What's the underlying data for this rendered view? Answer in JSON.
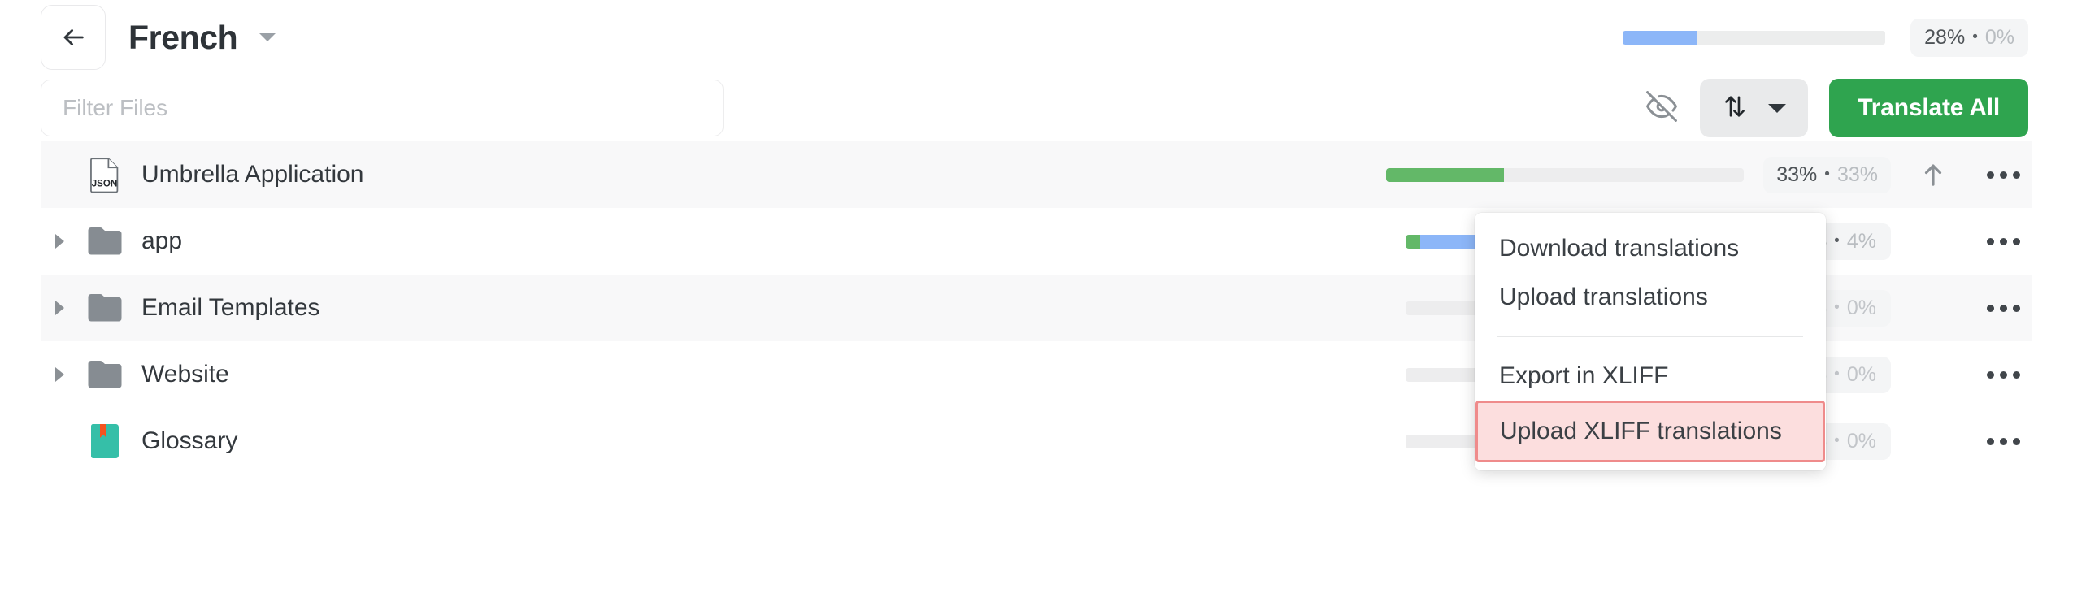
{
  "header": {
    "back_icon": "arrow-left-icon",
    "title": "French",
    "title_caret_icon": "chevron-down-icon",
    "progress_percent": 28,
    "stats_primary": "28%",
    "stats_separator": "•",
    "stats_secondary": "0%"
  },
  "toolbar": {
    "filter_placeholder": "Filter Files",
    "filter_value": "",
    "hide_icon": "eye-off-icon",
    "sort_icon": "sort-arrows-icon",
    "sort_caret_icon": "chevron-down-icon",
    "translate_all_label": "Translate All",
    "accent_green": "#2fa44f"
  },
  "menu": {
    "items": [
      {
        "label": "Download translations",
        "highlighted": false
      },
      {
        "label": "Upload translations",
        "highlighted": false
      },
      {
        "label": "Export in XLIFF",
        "highlighted": false
      },
      {
        "label": "Upload XLIFF translations",
        "highlighted": true
      }
    ],
    "highlight_border_color": "#ef8b8b",
    "highlight_background_color": "#fcdede"
  },
  "files": [
    {
      "name": "Umbrella Application",
      "icon": "json-file-icon",
      "expandable": false,
      "striped": true,
      "progress": {
        "green": 33,
        "blue": 0
      },
      "stats_primary": "33%",
      "stats_separator": "•",
      "stats_secondary": "33%",
      "stats_zero": false,
      "has_upload_action": true,
      "more_icon": "more-horizontal-icon"
    },
    {
      "name": "app",
      "icon": "folder-icon",
      "expandable": true,
      "striped": false,
      "progress": {
        "green": 4,
        "blue": 96
      },
      "stats_primary": "4%",
      "stats_separator": "•",
      "stats_secondary": "4%",
      "stats_zero": false,
      "has_upload_action": false,
      "more_icon": "more-horizontal-icon"
    },
    {
      "name": "Email Templates",
      "icon": "folder-icon",
      "expandable": true,
      "striped": true,
      "progress": {
        "green": 0,
        "blue": 0
      },
      "stats_primary": "0%",
      "stats_separator": "•",
      "stats_secondary": "0%",
      "stats_zero": true,
      "has_upload_action": false,
      "more_icon": "more-horizontal-icon"
    },
    {
      "name": "Website",
      "icon": "folder-icon",
      "expandable": true,
      "striped": false,
      "progress": {
        "green": 0,
        "blue": 0
      },
      "stats_primary": "0%",
      "stats_separator": "•",
      "stats_secondary": "0%",
      "stats_zero": true,
      "has_upload_action": false,
      "more_icon": "more-horizontal-icon"
    },
    {
      "name": "Glossary",
      "icon": "glossary-book-icon",
      "expandable": false,
      "striped": false,
      "progress": {
        "green": 0,
        "blue": 0
      },
      "stats_primary": "0%",
      "stats_separator": "•",
      "stats_secondary": "0%",
      "stats_zero": true,
      "has_upload_action": false,
      "more_icon": "more-horizontal-icon"
    }
  ]
}
